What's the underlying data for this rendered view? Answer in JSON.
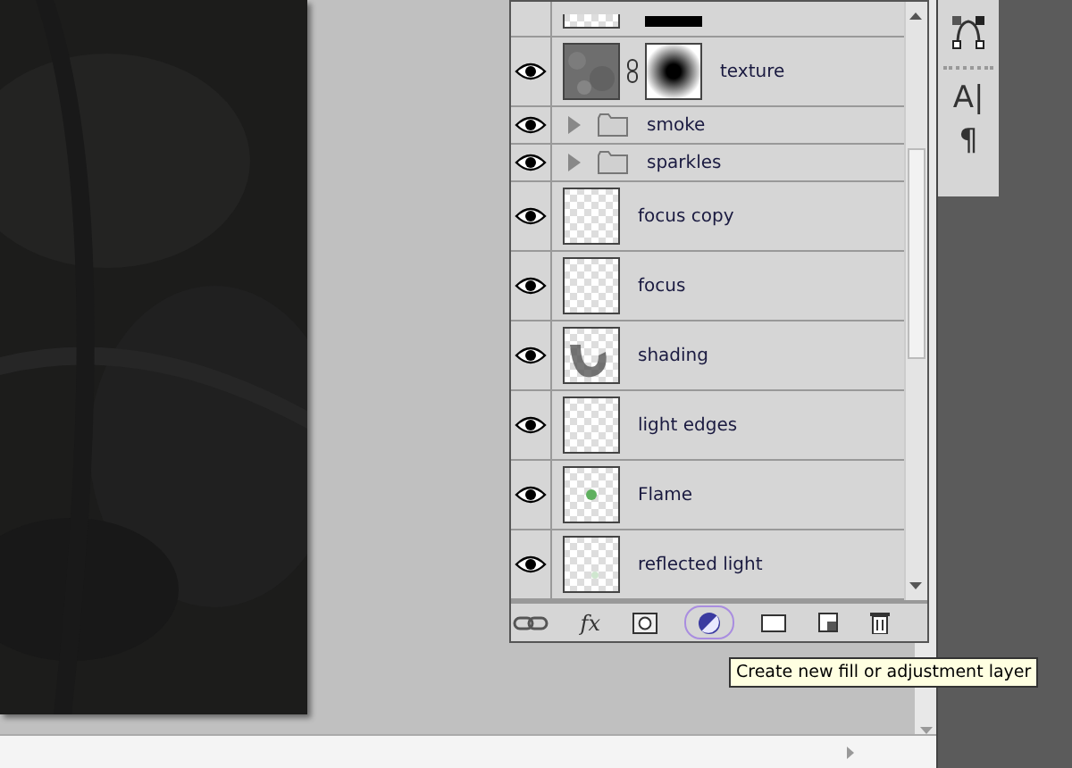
{
  "layers_panel": {
    "layers": [
      {
        "kind": "layer",
        "thumbnail": {
          "kind": "checker"
        },
        "mask": true
      },
      {
        "kind": "layer",
        "name": "texture",
        "visible": true,
        "thumbnail": {
          "kind": "noise"
        },
        "mask": true
      },
      {
        "kind": "group",
        "name": "smoke",
        "visible": true,
        "expanded": false
      },
      {
        "kind": "group",
        "name": "sparkles",
        "visible": true,
        "expanded": false
      },
      {
        "kind": "layer",
        "name": "focus copy",
        "visible": true,
        "thumbnail": {
          "kind": "checker"
        },
        "mask": false
      },
      {
        "kind": "layer",
        "name": "focus",
        "visible": true,
        "thumbnail": {
          "kind": "checker"
        },
        "mask": false
      },
      {
        "kind": "layer",
        "name": "shading",
        "visible": true,
        "thumbnail": {
          "kind": "smudge"
        },
        "mask": false
      },
      {
        "kind": "layer",
        "name": "light edges",
        "visible": true,
        "thumbnail": {
          "kind": "checker"
        },
        "mask": false
      },
      {
        "kind": "layer",
        "name": "Flame",
        "visible": true,
        "thumbnail": {
          "kind": "dot"
        },
        "mask": false
      },
      {
        "kind": "layer",
        "name": "reflected light",
        "visible": true,
        "thumbnail": {
          "kind": "faint"
        },
        "mask": false
      }
    ],
    "footer_buttons": [
      {
        "kind": "link",
        "selected": false
      },
      {
        "kind": "fx",
        "label": "fx",
        "selected": false
      },
      {
        "kind": "mask",
        "selected": false
      },
      {
        "kind": "adjustment",
        "selected": true
      },
      {
        "kind": "folder",
        "selected": false
      },
      {
        "kind": "new",
        "selected": false
      },
      {
        "kind": "trash",
        "selected": false
      }
    ]
  },
  "tooltip": "Create new fill or adjustment layer",
  "tool_strip": [
    {
      "kind": "path"
    },
    {
      "kind": "glyph",
      "text": "A|"
    },
    {
      "kind": "glyph",
      "text": "¶"
    }
  ]
}
